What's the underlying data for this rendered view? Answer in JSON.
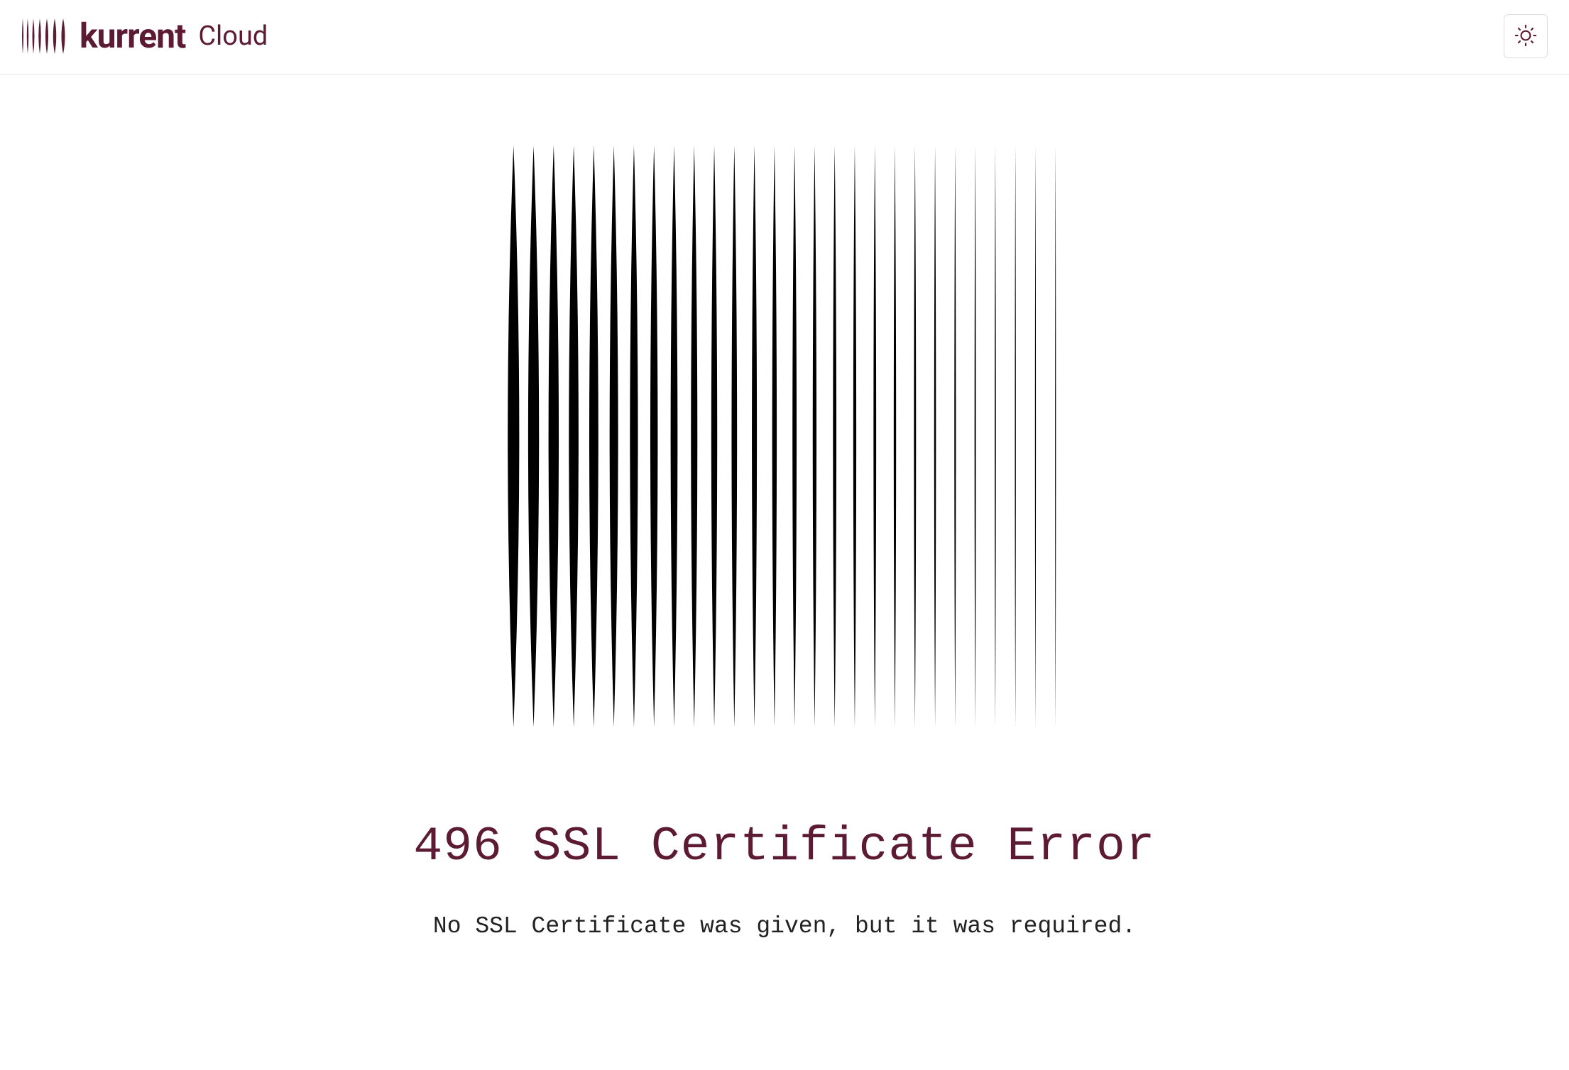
{
  "header": {
    "brand_name": "kurrent",
    "brand_suffix": "Cloud",
    "brand_color": "#5c1a33"
  },
  "error": {
    "title": "496 SSL Certificate Error",
    "message": "No SSL Certificate was given, but it was required."
  }
}
